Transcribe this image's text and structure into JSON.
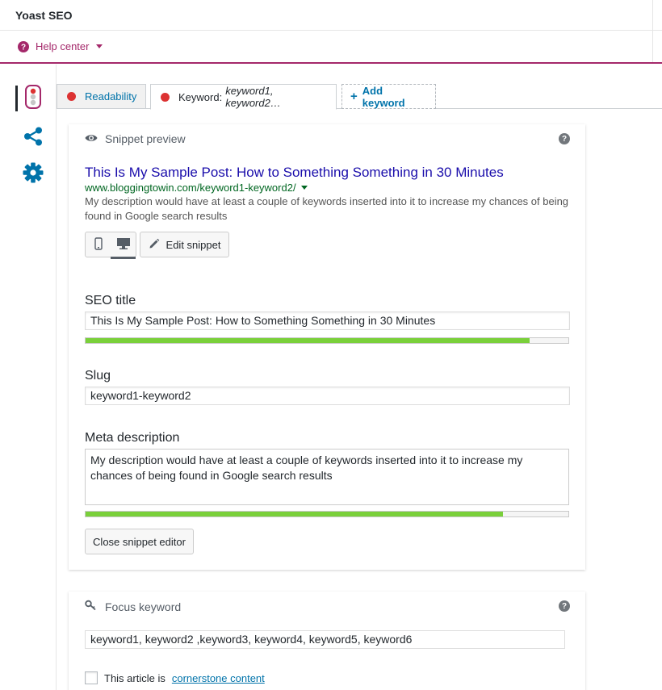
{
  "app": {
    "title": "Yoast SEO"
  },
  "help": {
    "label": "Help center"
  },
  "colors": {
    "brand": "#a4286a",
    "link": "#0073aa",
    "bad": "#dc3232",
    "good": "#7ad03a",
    "snippet_title": "#1a0dab",
    "snippet_url": "#006621"
  },
  "sidebar": {
    "items": [
      {
        "icon": "traffic-light-icon",
        "active": true
      },
      {
        "icon": "share-icon",
        "active": false
      },
      {
        "icon": "gear-icon",
        "active": false
      }
    ]
  },
  "tabs": {
    "readability": {
      "label": "Readability",
      "status": "bad"
    },
    "keyword": {
      "prefix": "Keyword:",
      "value": "keyword1, keyword2…",
      "status": "bad"
    },
    "add": {
      "label": "Add keyword"
    }
  },
  "snippet": {
    "heading": "Snippet preview",
    "help_symbol": "?",
    "title": "This Is My Sample Post: How to Something Something in 30 Minutes",
    "url": "www.bloggingtowin.com/keyword1-keyword2/",
    "description": "My description would have at least a couple of keywords inserted into it to increase my chances of being found in Google search results",
    "device_mode": "desktop",
    "edit_label": "Edit snippet"
  },
  "editor": {
    "seo_title": {
      "label": "SEO title",
      "value": "This Is My Sample Post: How to Something Something in 30 Minutes",
      "progress": 0.92
    },
    "slug": {
      "label": "Slug",
      "value": "keyword1-keyword2"
    },
    "meta": {
      "label": "Meta description",
      "value": "My description would have at least a couple of keywords inserted into it to increase my chances of being found in Google search results",
      "progress": 0.865
    },
    "close_label": "Close snippet editor"
  },
  "focus": {
    "heading": "Focus keyword",
    "help_symbol": "?",
    "value": "keyword1, keyword2 ,keyword3, keyword4, keyword5, keyword6",
    "cornerstone_prefix": "This article is",
    "cornerstone_link": "cornerstone content",
    "cornerstone_checked": false
  }
}
